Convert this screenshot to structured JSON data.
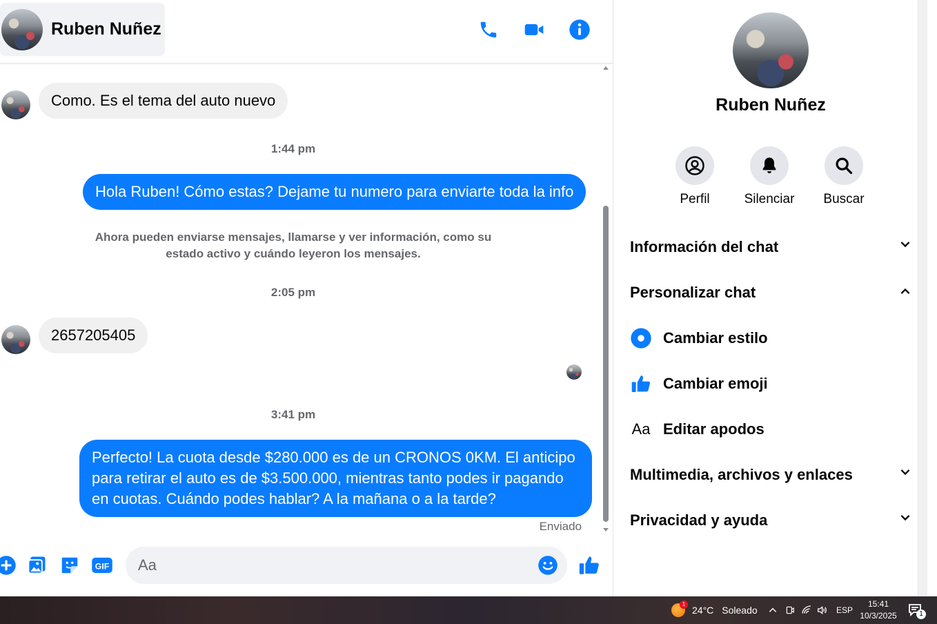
{
  "header": {
    "contact_name": "Ruben Nuñez",
    "icons": [
      "phone-icon",
      "video-call-icon",
      "info-icon"
    ]
  },
  "messages": {
    "incoming_1": "Como. Es el tema del auto nuevo",
    "time_1": "1:44 pm",
    "outgoing_1": "Hola Ruben! Cómo estas? Dejame tu numero para enviarte toda la info",
    "system_note": "Ahora pueden enviarse mensajes, llamarse y ver información, como su estado activo y cuándo leyeron los mensajes.",
    "time_2": "2:05 pm",
    "incoming_2": "2657205405",
    "time_3": "3:41 pm",
    "outgoing_2": "Perfecto! La cuota desde $280.000 es de un CRONOS 0KM. El anticipo para retirar el auto es de $3.500.000, mientras tanto podes ir pagando en cuotas. Cuándo podes hablar? A la mañana o a la tarde?",
    "status": "Enviado"
  },
  "composer": {
    "placeholder": "Aa",
    "icons": [
      "plus-icon",
      "image-icon",
      "sticker-icon",
      "gif-icon",
      "emoji-icon",
      "thumbs-up-icon"
    ]
  },
  "panel": {
    "name": "Ruben Nuñez",
    "actions": [
      {
        "label": "Perfil",
        "icon": "profile-icon"
      },
      {
        "label": "Silenciar",
        "icon": "bell-icon"
      },
      {
        "label": "Buscar",
        "icon": "search-icon"
      }
    ],
    "sections": {
      "chat_info": "Información del chat",
      "customize": "Personalizar chat",
      "media": "Multimedia, archivos y enlaces",
      "privacy": "Privacidad y ayuda"
    },
    "options": {
      "style": "Cambiar estilo",
      "emoji": "Cambiar emoji",
      "nicknames_icon_text": "Aa",
      "nicknames": "Editar apodos"
    }
  },
  "taskbar": {
    "weather_badge": "1",
    "weather": "24°C",
    "condition": "Soleado",
    "language": "ESP",
    "time": "15:41",
    "date": "10/3/2025",
    "notification_count": "1"
  },
  "colors": {
    "accent": "#0a7cff",
    "bubble_incoming": "#f0f0f0",
    "muted_text": "#65676b"
  }
}
